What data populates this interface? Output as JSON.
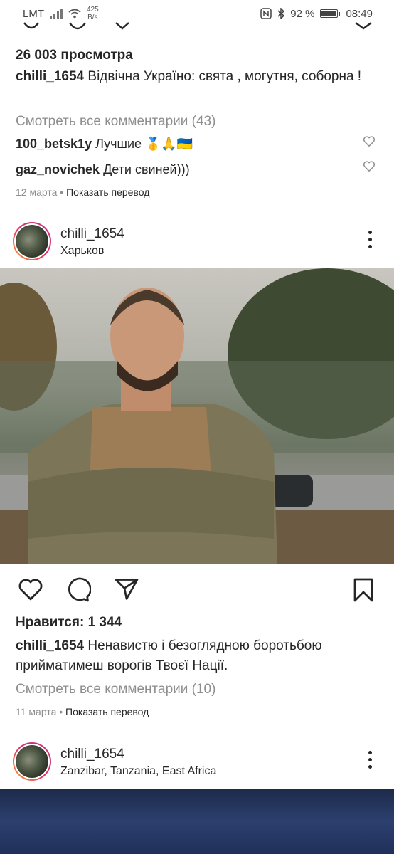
{
  "status_bar": {
    "carrier": "LMT",
    "net_speed_value": "425",
    "net_speed_unit": "B/s",
    "battery": "92 %",
    "battery_level": 0.92,
    "time": "08:49"
  },
  "post1": {
    "views": "26 003 просмотра",
    "username": "chilli_1654",
    "caption": "Відвічна Україно: свята , могутня, соборна !",
    "view_all_comments": "Смотреть все комментарии (43)",
    "comments": [
      {
        "username": "100_betsk1y",
        "text": "Лучшие 🥇🙏🇺🇦"
      },
      {
        "username": "gaz_novichek",
        "text": "Дети свиней)))"
      }
    ],
    "date": "12 марта",
    "translate": "Показать перевод"
  },
  "post2": {
    "username": "chilli_1654",
    "location": "Харьков",
    "likes": "Нравится: 1 344",
    "caption_username": "chilli_1654",
    "caption": "Ненавистю і безоглядною боротьбою прийматимеш ворогів Твоєї Нації.",
    "view_all_comments": "Смотреть все комментарии (10)",
    "date": "11 марта",
    "translate": "Показать перевод"
  },
  "post3": {
    "username": "chilli_1654",
    "location": "Zanzibar, Tanzania, East Africa"
  }
}
